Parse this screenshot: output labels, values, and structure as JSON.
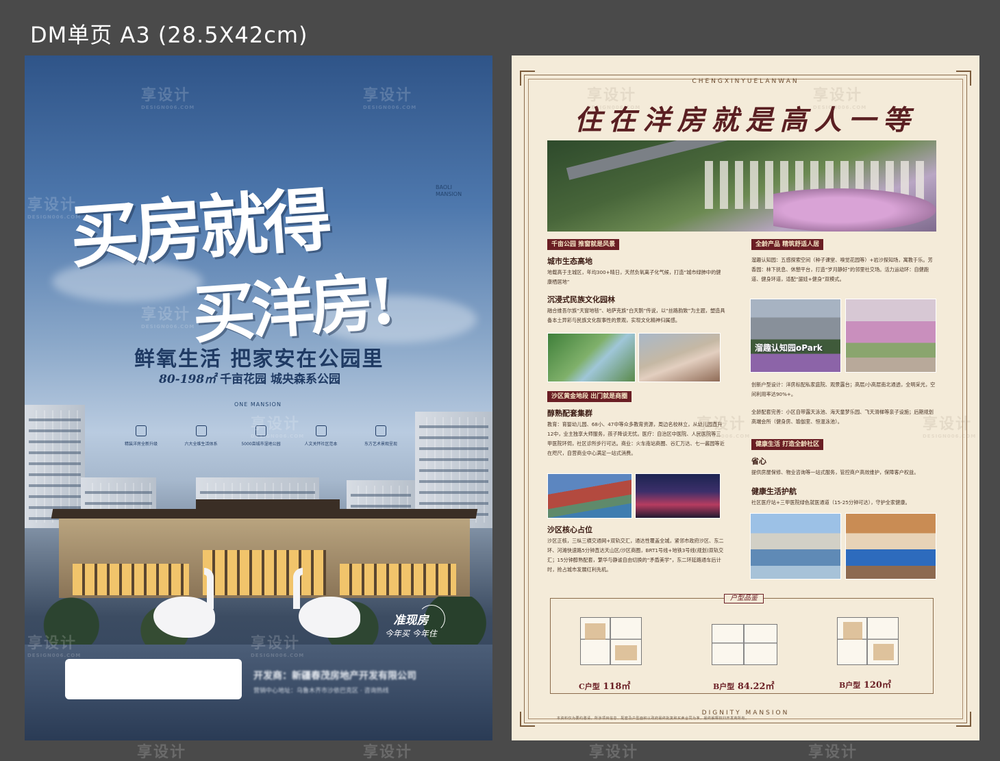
{
  "page_title": "DM单页  A3 (28.5X42cm)",
  "front": {
    "headline_line1": "买房就得",
    "headline_line2": "买洋房!",
    "brand_vertical": "BAOLI MANSION",
    "tagline": "鲜氧生活  把家安在公园里",
    "area_range": "80-198㎡",
    "area_desc": " 千亩花园 城央森系公园",
    "one_mansion": "ONE MANSION",
    "features": [
      {
        "icon": "building-icon",
        "label": "精装洋房全新升级"
      },
      {
        "icon": "grid-icon",
        "label": "六大全维生活体系"
      },
      {
        "icon": "park-icon",
        "label": "5000亩城市湿地公园"
      },
      {
        "icon": "shield-icon",
        "label": "人文关怀社区范本"
      },
      {
        "icon": "flag-icon",
        "label": "东方艺术景观呈现"
      }
    ],
    "ready_title": "准现房",
    "ready_sub": "今年买 今年住",
    "developer": "开发商：新疆春茂房地产开发有限公司",
    "developer_addr": "营销中心地址：乌鲁木齐市沙依巴克区 · 咨询热线"
  },
  "back": {
    "tag_top": "CHENGXINYUELANWAN",
    "title": "住在洋房就是高人一等",
    "tag_bottom": "DIGNITY MANSION",
    "sections_left": [
      {
        "tag": "千亩公园 推窗就是风景",
        "blocks": [
          {
            "heading": "城市生态高地",
            "text": "地载高于主城区，年均300+晴日，天然负氧离子化气候，打造“城市绿肺中的健康栖居地”"
          },
          {
            "heading": "沉浸式民族文化园林",
            "text": "融合维吾尔族“天窗地毯”、哈萨克族“白天鹅”传说，以“丝路韵致”为主题，塑造具备本土异彩与民族文化叙事性的景观，实现文化精神归属感。"
          }
        ]
      },
      {
        "tag": "沙区黄金地段 出门就是商圈",
        "blocks": [
          {
            "heading": "醇熟配套集群",
            "text": "教育：育婴幼儿园、68小、47中等众多教育资源，周边名校林立，从幼儿园直升12中，业主独享大师服务，孩子降谈无忧。医疗：自治区中医院、人民医院等三甲医院环伺，社区诊所步行可达。商业：火车南站商圈、谷汇万达、七一酱园等近在咫尺，自营商业中心满足一站式消费。"
          },
          {
            "heading": "沙区核心占位",
            "text": "沙区正核，三纵三横交通网+双轨交汇，通达性覆盖全城，紧邻市政府沙区、东二环、河滩快速路5分钟直达天山区/沙区商圈，BRT1号线+地铁3号线(规划)双轨交汇；15分钟醇熟配套，繁华与静谧自由切换的“矛盾美学”，东二环延路通车后计时，抢占城市发展红利先机。"
          }
        ]
      }
    ],
    "sections_right": [
      {
        "tag": "全龄产品 精筑舒适人居",
        "text": "溜趣认知园：五感探索空间（种子课堂、嗅觉花园等）+岩沙探知场，寓教于乐。芳香园：林下抚息、休憩平台，打造“岁月静好”的邻里社交场。活力运动环：自健跑道、健身环道，适配“遛娃+健身”双模式。",
        "text2": "创新户型设计：洋房标配私家庭院、观景露台；高层/小高层南北通透，全明采光，空间利用率达90%+。",
        "text3": "全龄配套完善：小区自带露天泳池、海天童梦乐园、飞天滑梯等亲子设施；后期规划高端会所（健身房、瑜伽室、恒温泳池）。"
      },
      {
        "tag": "健康生活 打造全龄社区",
        "blocks": [
          {
            "heading": "省心",
            "text": "提供房屋保修、物业咨询等一站式服务，管控商户高效维护，保障客户权益。"
          },
          {
            "heading": "健康生活护航",
            "text": "社区医疗站+三甲医院绿色就医通道（15-25分钟可达），守护全家健康。"
          }
        ]
      }
    ],
    "photo_label_park": "溜趣认知园oPark",
    "plans_tag": "户型品鉴",
    "plans": [
      {
        "type": "C户型",
        "area": "118㎡"
      },
      {
        "type": "B户型",
        "area": "84.22㎡"
      },
      {
        "type": "B户型",
        "area": "120㎡"
      }
    ],
    "footnote": "本资料仅为要约邀请，所涉项目信息、配套及户型面积以政府最终批复和买卖合同为准，最终解释权归开发商所有。"
  },
  "watermark": {
    "cn": "享设计",
    "en": "DESIGN006.COM"
  }
}
